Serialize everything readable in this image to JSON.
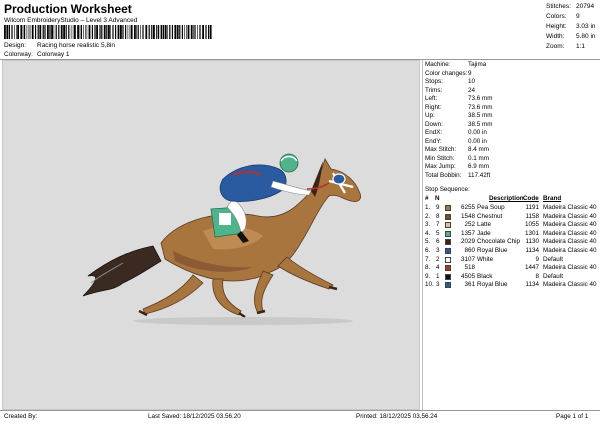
{
  "header": {
    "title": "Production Worksheet",
    "subtitle": "Wilcom EmbroideryStudio – Level 3 Advanced",
    "design_label": "Design:",
    "design_value": "Racing horse realistic 5,8in",
    "colorway_label": "Colorway:",
    "colorway_value": "Colorway 1"
  },
  "top_stats": [
    {
      "label": "Stitches:",
      "value": "20794"
    },
    {
      "label": "Colors:",
      "value": "9"
    },
    {
      "label": "Height:",
      "value": "3.03 in"
    },
    {
      "label": "Width:",
      "value": "5.80 in"
    },
    {
      "label": "Zoom:",
      "value": "1:1"
    }
  ],
  "machine_stats": [
    {
      "label": "Machine:",
      "value": "Tajima"
    },
    {
      "label": "Color changes:",
      "value": "9"
    },
    {
      "label": "Stops:",
      "value": "10"
    },
    {
      "label": "Trims:",
      "value": "24"
    },
    {
      "label": "Left:",
      "value": "73.6 mm"
    },
    {
      "label": "Right:",
      "value": "73.6 mm"
    },
    {
      "label": "Up:",
      "value": "38.5 mm"
    },
    {
      "label": "Down:",
      "value": "38.5 mm"
    },
    {
      "label": "EndX:",
      "value": "0.00 in"
    },
    {
      "label": "EndY:",
      "value": "0.00 in"
    },
    {
      "label": "Max Stitch:",
      "value": "8.4 mm"
    },
    {
      "label": "Min Stitch:",
      "value": "0.1 mm"
    },
    {
      "label": "Max Jump:",
      "value": "6.9 mm"
    },
    {
      "label": "Total Bobbin:",
      "value": "117.42ft"
    }
  ],
  "sequence": {
    "title": "Stop Sequence:",
    "columns": {
      "stop": "#",
      "n": "N",
      "description": "Description",
      "code": "Code",
      "brand": "Brand"
    },
    "rows": [
      {
        "stop": "1.",
        "n": "9",
        "color": "#a9753f",
        "num": "6255",
        "desc": "Pea Soup",
        "code": "1191",
        "brand": "Madeira Classic 40"
      },
      {
        "stop": "2.",
        "n": "8",
        "color": "#7a4a2e",
        "num": "1548",
        "desc": "Chestnut",
        "code": "1158",
        "brand": "Madeira Classic 40"
      },
      {
        "stop": "3.",
        "n": "7",
        "color": "#d6c39a",
        "num": "252",
        "desc": "Latte",
        "code": "1055",
        "brand": "Madeira Classic 40"
      },
      {
        "stop": "4.",
        "n": "5",
        "color": "#4fb48c",
        "num": "1357",
        "desc": "Jade",
        "code": "1301",
        "brand": "Madeira Classic 40"
      },
      {
        "stop": "5.",
        "n": "6",
        "color": "#3a2418",
        "num": "2029",
        "desc": "Chocolate Chip",
        "code": "1130",
        "brand": "Madeira Classic 40"
      },
      {
        "stop": "6.",
        "n": "3",
        "color": "#2a5aa0",
        "num": "860",
        "desc": "Royal Blue",
        "code": "1134",
        "brand": "Madeira Classic 40"
      },
      {
        "stop": "7.",
        "n": "2",
        "color": "#ffffff",
        "num": "3107",
        "desc": "White",
        "code": "9",
        "brand": "Default"
      },
      {
        "stop": "8.",
        "n": "4",
        "color": "#b8302a",
        "num": "518",
        "desc": "",
        "code": "1447",
        "brand": "Madeira Classic 40"
      },
      {
        "stop": "9.",
        "n": "1",
        "color": "#111111",
        "num": "4505",
        "desc": "Black",
        "code": "8",
        "brand": "Default"
      },
      {
        "stop": "10.",
        "n": "3",
        "color": "#2a5aa0",
        "num": "361",
        "desc": "Royal Blue",
        "code": "1134",
        "brand": "Madeira Classic 40"
      }
    ]
  },
  "footer": {
    "created_by": "Created By:",
    "last_saved": "Last Saved: 18/12/2025 03.56.20",
    "printed": "Printed: 18/12/2025 03.56.24",
    "page": "Page 1 of 1"
  },
  "colors": {
    "panel_bg": "#dcdcdc",
    "horse_coat": "#a9753f",
    "silks_blue": "#2a5aa0",
    "silks_green": "#4fb48c"
  }
}
